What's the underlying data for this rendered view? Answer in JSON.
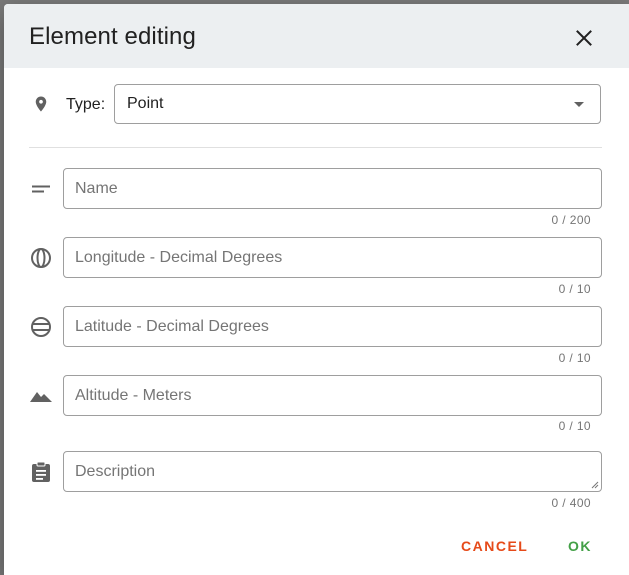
{
  "dialog": {
    "title": "Element editing",
    "close_icon": "close-icon"
  },
  "type_row": {
    "icon": "map-pin-icon",
    "label": "Type:",
    "selected": "Point"
  },
  "fields": [
    {
      "icon": "short-text-icon",
      "placeholder": "Name",
      "value": "",
      "counter": "0 / 200"
    },
    {
      "icon": "longitude-globe-icon",
      "placeholder": "Longitude - Decimal Degrees",
      "value": "",
      "counter": "0 / 10"
    },
    {
      "icon": "latitude-globe-icon",
      "placeholder": "Latitude - Decimal Degrees",
      "value": "",
      "counter": "0 / 10"
    },
    {
      "icon": "terrain-icon",
      "placeholder": "Altitude - Meters",
      "value": "",
      "counter": "0 / 10"
    },
    {
      "icon": "clipboard-icon",
      "placeholder": "Description",
      "value": "",
      "counter": "0 / 400"
    }
  ],
  "actions": {
    "cancel_label": "CANCEL",
    "ok_label": "OK"
  },
  "colors": {
    "header_bg": "#eceff1",
    "cancel": "#e64a19",
    "ok": "#43a047",
    "icon": "#616161"
  }
}
